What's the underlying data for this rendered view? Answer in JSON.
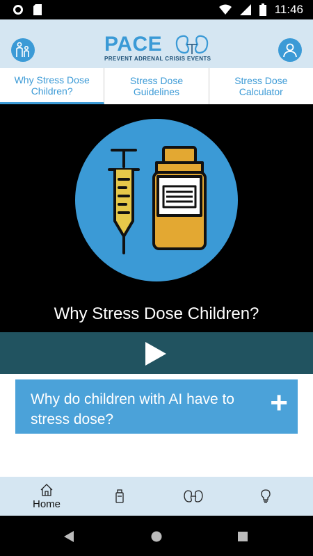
{
  "status_bar": {
    "time": "11:46"
  },
  "header": {
    "logo_title": "PACE",
    "logo_subtitle": "PREVENT ADRENAL CRISIS EVENTS"
  },
  "tabs": [
    {
      "label": "Why Stress Dose Children?",
      "active": true
    },
    {
      "label": "Stress Dose Guidelines",
      "active": false
    },
    {
      "label": "Stress Dose Calculator",
      "active": false
    }
  ],
  "video": {
    "title": "Why Stress Dose Children?"
  },
  "accordion": {
    "question": "Why do children with AI have to stress dose?",
    "expand_icon": "plus-icon"
  },
  "bottom_nav": [
    {
      "label": "Home",
      "icon": "home-icon"
    },
    {
      "label": "",
      "icon": "medicine-bottle-icon"
    },
    {
      "label": "",
      "icon": "kidneys-icon"
    },
    {
      "label": "",
      "icon": "lightbulb-icon"
    }
  ],
  "colors": {
    "accent": "#3b9ad6",
    "header_bg": "#d5e6f2",
    "playbar_bg": "#215360",
    "accordion_bg": "#4ba2d9"
  }
}
